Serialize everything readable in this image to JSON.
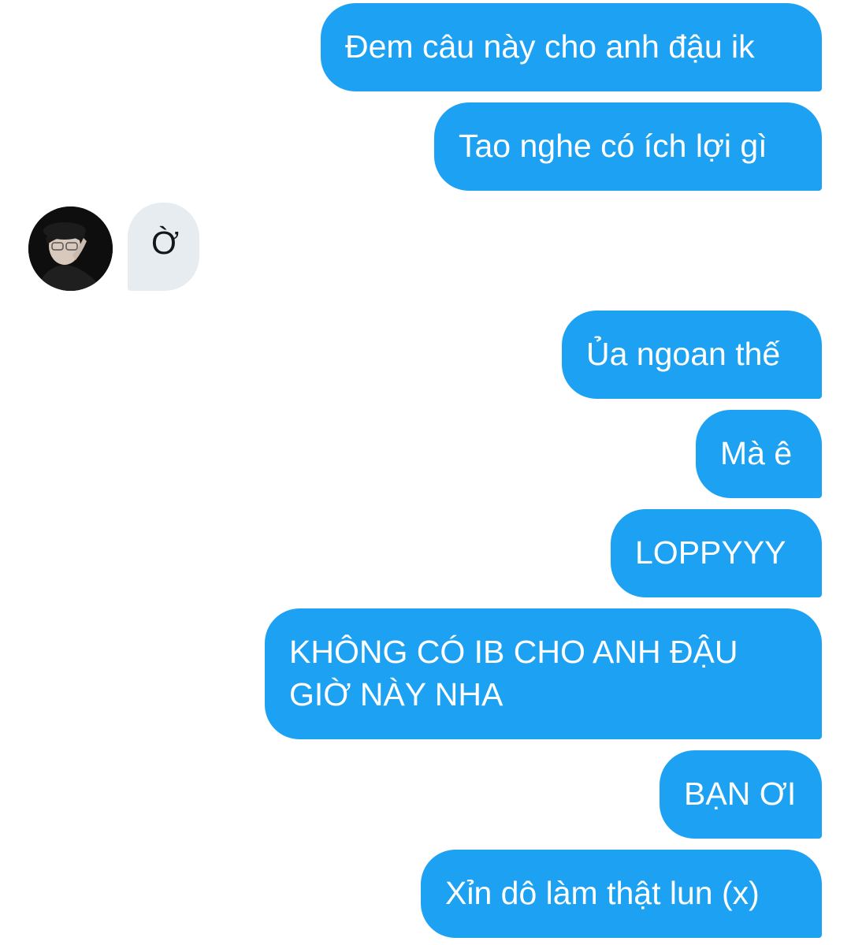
{
  "messages": [
    {
      "id": "m1",
      "direction": "sent",
      "text": "Đem câu này cho anh đậu ik"
    },
    {
      "id": "m2",
      "direction": "sent",
      "text": "Tao nghe có ích lợi gì"
    },
    {
      "id": "m3",
      "direction": "received",
      "text": "Ờ",
      "avatar": "user-avatar"
    },
    {
      "id": "m4",
      "direction": "sent",
      "text": "Ủa ngoan thế"
    },
    {
      "id": "m5",
      "direction": "sent",
      "text": "Mà ê"
    },
    {
      "id": "m6",
      "direction": "sent",
      "text": "LOPPYYY"
    },
    {
      "id": "m7",
      "direction": "sent",
      "text": "KHÔNG CÓ IB CHO ANH ĐẬU GIỜ NÀY NHA"
    },
    {
      "id": "m8",
      "direction": "sent",
      "text": "BẠN ƠI"
    },
    {
      "id": "m9",
      "direction": "sent",
      "text": "Xỉn dô làm thật lun (x)"
    }
  ],
  "colors": {
    "sent_bubble": "#1da1f2",
    "sent_text": "#ffffff",
    "received_bubble": "#e6ecf0",
    "received_text": "#14171a",
    "background": "#ffffff"
  }
}
